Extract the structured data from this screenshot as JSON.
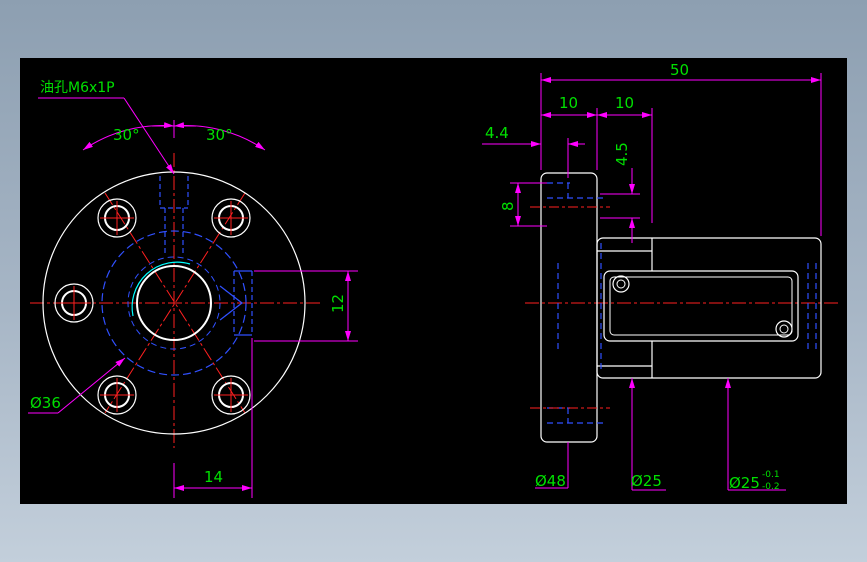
{
  "colors": {
    "background": "#000000",
    "outline": "#ffffff",
    "dimension": "#ff00ff",
    "center": "#ff2020",
    "hidden": "#3050ff",
    "text": "#00e000",
    "cyan": "#00ffff"
  },
  "labels": {
    "oil_hole": "油孔M6x1P",
    "angle_left": "30°",
    "angle_right": "30°",
    "dia_36": "Ø36",
    "dim_14": "14",
    "dim_12": "12",
    "dim_50": "50",
    "dim_10_a": "10",
    "dim_10_b": "10",
    "dim_4_4": "4.4",
    "dim_4_5": "4.5",
    "dim_8": "8",
    "dia_48": "Ø48",
    "dia_25": "Ø25",
    "dia_25_tol": "Ø25",
    "tol_upper": "-0.1",
    "tol_lower": "-0.2"
  }
}
